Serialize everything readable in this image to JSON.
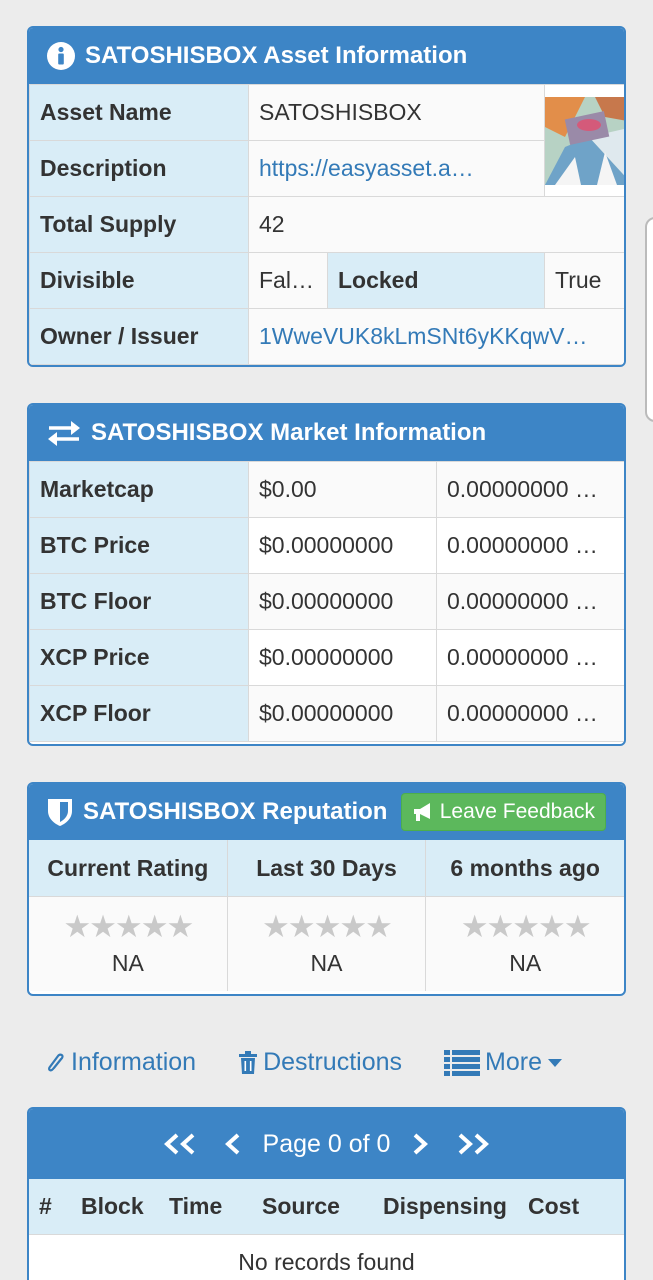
{
  "asset_panel": {
    "title": "SATOSHISBOX Asset Information",
    "rows": {
      "asset_name": {
        "label": "Asset Name",
        "value": "SATOSHISBOX"
      },
      "description": {
        "label": "Description",
        "value": "https://easyasset.a…"
      },
      "total_supply": {
        "label": "Total Supply",
        "value": "42"
      },
      "divisible": {
        "label": "Divisible",
        "value": "Fal…"
      },
      "locked": {
        "label": "Locked",
        "value": "True"
      },
      "owner": {
        "label": "Owner / Issuer",
        "value": "1WweVUK8kLmSNt6yKKqwV…"
      }
    }
  },
  "market_panel": {
    "title": "SATOSHISBOX Market Information",
    "rows": [
      {
        "label": "Marketcap",
        "usd": "$0.00",
        "btc": "0.00000000 …"
      },
      {
        "label": "BTC Price",
        "usd": "$0.00000000",
        "btc": "0.00000000 …"
      },
      {
        "label": "BTC Floor",
        "usd": "$0.00000000",
        "btc": "0.00000000 …"
      },
      {
        "label": "XCP Price",
        "usd": "$0.00000000",
        "btc": "0.00000000 …"
      },
      {
        "label": "XCP Floor",
        "usd": "$0.00000000",
        "btc": "0.00000000 …"
      }
    ]
  },
  "reputation_panel": {
    "title": "SATOSHISBOX Reputation",
    "feedback_button": "Leave Feedback",
    "columns": [
      {
        "header": "Current Rating",
        "value": "NA"
      },
      {
        "header": "Last 30 Days",
        "value": "NA"
      },
      {
        "header": "6 months ago",
        "value": "NA"
      }
    ],
    "stars": "★★★★★"
  },
  "nav": {
    "information": "Information",
    "destructions": "Destructions",
    "more": "More"
  },
  "records_table": {
    "page_label": "Page 0 of 0",
    "columns": [
      "#",
      "Block",
      "Time",
      "Source",
      "Dispensing",
      "Cost"
    ],
    "empty_message": "No records found"
  },
  "colors": {
    "panel_blue": "#3d85c6",
    "label_bg": "#d9edf7",
    "link": "#337ab7",
    "feedback_green": "#5cb85c"
  }
}
